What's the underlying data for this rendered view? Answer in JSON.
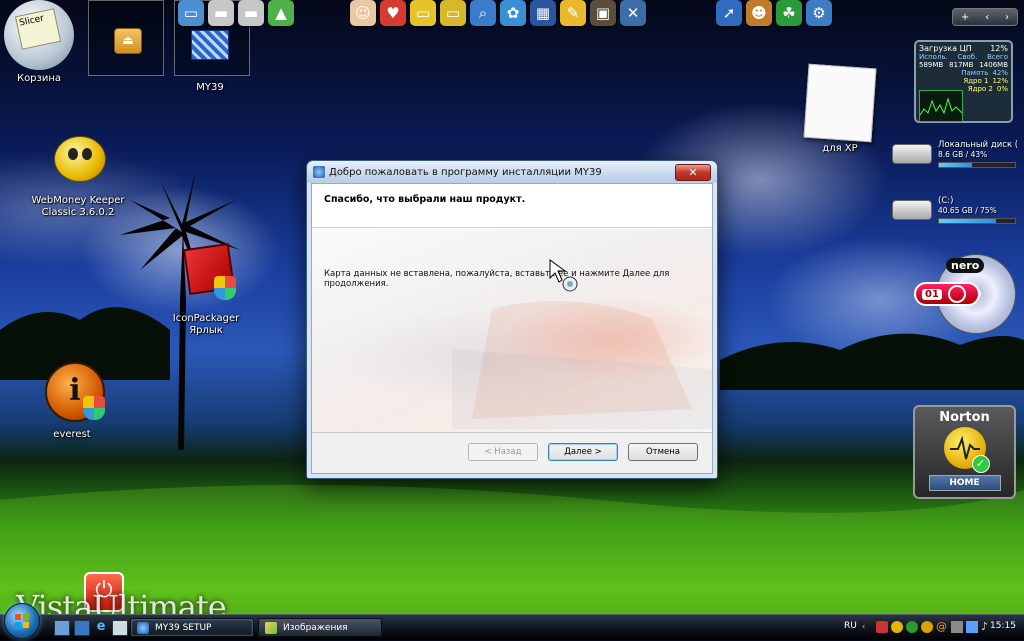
{
  "desktop": {
    "icons": [
      {
        "label": "Корзина"
      },
      {
        "label": "MY39"
      },
      {
        "label": "WebMoney Keeper Classic 3.6.0.2"
      },
      {
        "label": "IconPackager Ярлык"
      },
      {
        "label": "everest"
      },
      {
        "label": "для XP"
      }
    ],
    "recycle_note": "Slicer",
    "wallpaper_text": "VistaUltimate"
  },
  "dialog": {
    "title": "Добро пожаловать в программу инсталляции MY39",
    "heading": "Спасибо, что выбрали наш продукт.",
    "message": "Карта данных не вставлена, пожалуйста, вставьте ее и нажмите Далее для продолжения.",
    "buttons": {
      "back": "< Назад",
      "next": "Далее >",
      "cancel": "Отмена"
    }
  },
  "gadgets": {
    "cpu": {
      "title": "Загрузка ЦП",
      "value": "12%",
      "cols": [
        "Исполь.",
        "Своб.",
        "Всего"
      ],
      "vals": [
        "589MB",
        "817MB",
        "1406MB"
      ],
      "memory_label": "Память",
      "memory_value": "42%",
      "core1_label": "Ядро 1",
      "core1_value": "12%",
      "core2_label": "Ядро 2",
      "core2_value": "0%"
    },
    "drives": [
      {
        "name": "Локальный диск (",
        "size": "8.6 GB / 43%",
        "fill": 0.43
      },
      {
        "name": "(C:)",
        "size": "40.65 GB / 75%",
        "fill": 0.75
      }
    ],
    "nero": {
      "brand": "nero",
      "badge": "01"
    },
    "norton": {
      "brand": "Norton",
      "home": "HOME"
    }
  },
  "taskbar": {
    "tasks": [
      {
        "label": "MY39 SETUP",
        "active": true
      },
      {
        "label": "Изображения",
        "active": false
      }
    ],
    "language": "RU",
    "clock": "15:15"
  }
}
